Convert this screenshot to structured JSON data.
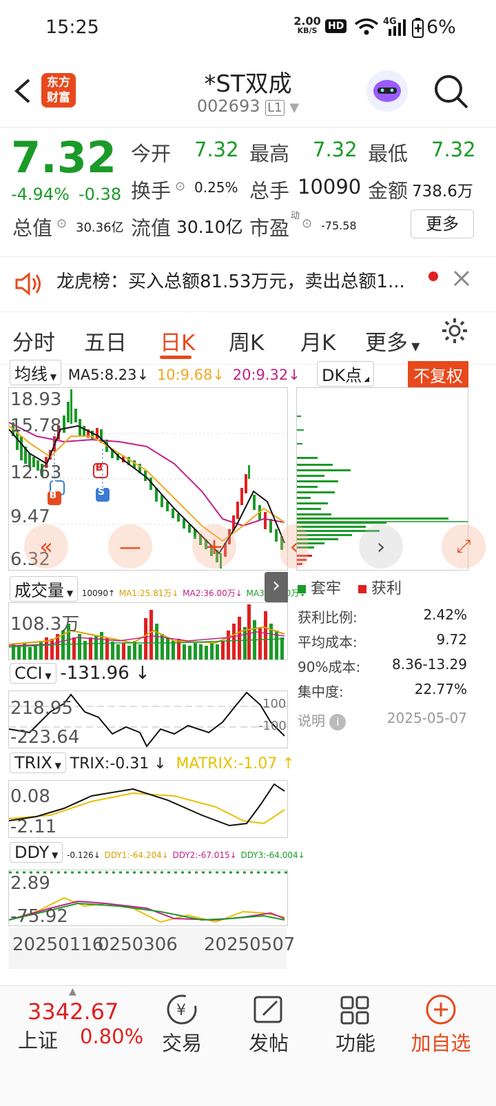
{
  "status": {
    "time": "15:25",
    "speed_top": "2.00",
    "speed_bottom": "KB/S",
    "hd": "HD",
    "net": "4G",
    "battery": "6%"
  },
  "header": {
    "brand_top": "东方",
    "brand_bottom": "财富",
    "title": "*ST双成",
    "code": "002693",
    "level": "L1"
  },
  "quote": {
    "price": "7.32",
    "change_pct": "-4.94%",
    "change": "-0.38",
    "open_label": "今开",
    "open": "7.32",
    "high_label": "最高",
    "high": "7.32",
    "low_label": "最低",
    "low": "7.32",
    "turnover_label": "换手",
    "turnover": "0.25%",
    "volume_label": "总手",
    "volume": "10090",
    "amount_label": "金额",
    "amount": "738.6万",
    "mcap_label": "总值",
    "mcap": "30.36亿",
    "float_label": "流值",
    "float": "30.10亿",
    "pe_label": "市盈",
    "pe_sup": "动",
    "pe": "-75.58",
    "more": "更多"
  },
  "notice": {
    "label": "龙虎榜",
    "text": "：买入总额81.53万元，卖出总额1..."
  },
  "tabs": [
    "分时",
    "五日",
    "日K",
    "周K",
    "月K",
    "更多"
  ],
  "chart_header": {
    "ma_select": "均线",
    "ma5": "MA5:8.23",
    "ma10": "10:9.68",
    "ma20": "20:9.32",
    "dk": "DK点",
    "fq": "不复权",
    "down": "↓"
  },
  "vol_header": {
    "select": "成交量",
    "v": "10090↑",
    "ma1": "MA1:25.81万↓",
    "ma2": "MA2:36.00万↓",
    "ma3": "MA3:36.00万↓"
  },
  "cci_header": {
    "select": "CCI",
    "value": "-131.96"
  },
  "trix_header": {
    "select": "TRIX",
    "trix": "TRIX:-0.31",
    "matrix": "MATRIX:-1.07"
  },
  "ddy_header": {
    "select": "DDY",
    "ddy": "-0.126↓",
    "ddy1": "DDY1:-64.204↓",
    "ddy2": "DDY2:-67.015↓",
    "ddy3": "DDY3:-64.004↓"
  },
  "axes": {
    "k": [
      "18.93",
      "15.78",
      "12.63",
      "9.47",
      "6.32"
    ],
    "vol": "108.3万",
    "cci": [
      "218.95",
      "-223.64"
    ],
    "cci_ref": [
      "100",
      "-100"
    ],
    "trix": [
      "0.08",
      "-2.11"
    ],
    "ddy": [
      "2.89",
      "-75.92"
    ],
    "dates": [
      "20250116",
      "0250306",
      "20250507"
    ]
  },
  "signals": {
    "b": "B",
    "s": "S"
  },
  "chip": {
    "legend_trapped": "套牢",
    "legend_profit": "获利",
    "rows": [
      {
        "label": "获利比例:",
        "value": "2.42%"
      },
      {
        "label": "平均成本:",
        "value": "9.72"
      },
      {
        "label": "90%成本:",
        "value": "8.36-13.29"
      },
      {
        "label": "集中度:",
        "value": "22.77%"
      }
    ],
    "note": "说明",
    "date": "2025-05-07"
  },
  "footer": {
    "index_value": "3342.67",
    "index_name": "上证",
    "index_pct": "0.80%",
    "items": [
      "交易",
      "发帖",
      "功能",
      "加自选"
    ]
  },
  "colors": {
    "up": "#e02020",
    "down": "#1a9a28",
    "accent": "#e8491c",
    "ma5": "#111111",
    "ma10": "#f0a820",
    "ma20": "#c0208a"
  }
}
